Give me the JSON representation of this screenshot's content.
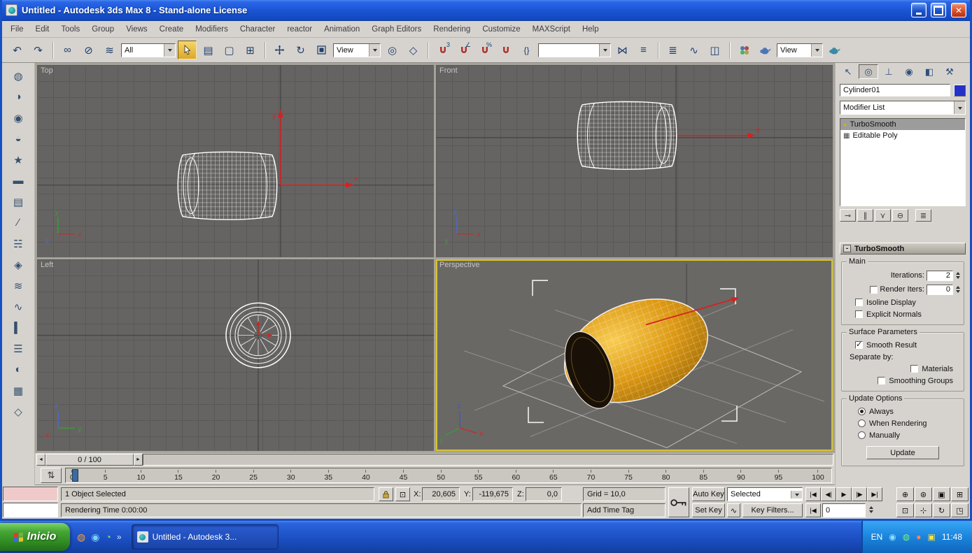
{
  "window": {
    "title": "Untitled - Autodesk 3ds Max 8  - Stand-alone License"
  },
  "menubar": {
    "items": [
      "File",
      "Edit",
      "Tools",
      "Group",
      "Views",
      "Create",
      "Modifiers",
      "Character",
      "reactor",
      "Animation",
      "Graph Editors",
      "Rendering",
      "Customize",
      "MAXScript",
      "Help"
    ]
  },
  "toolbar": {
    "selection_filter_value": "All",
    "ref_coord_value": "View",
    "named_sets_value": "",
    "render_type_value": "View"
  },
  "icons": {
    "undo": "↶",
    "redo": "↷",
    "link": "∞",
    "unlink": "⊘",
    "spacewarp": "≋",
    "select_by_name": "▤",
    "rect_region": "▢",
    "window_crossing": "⊞",
    "rotate": "↻",
    "pivot_center": "◎",
    "manipulate": "◇",
    "snap_super": "3",
    "angle_snap": "∠",
    "percent_snap": "%",
    "named_sets": "{}",
    "mirror": "⋈",
    "align": "≡",
    "layers": "≣",
    "curve_editor": "∿",
    "schematic": "◫",
    "abs_mode": "⊡",
    "mini_curve": "⇅",
    "key_mode": "∿",
    "zoom": "⊕",
    "zoom_all": "⊛",
    "zoom_extents": "▣",
    "zoom_extents_all": "⊞",
    "zoom_region": "⊡",
    "pan": "⊹",
    "arc_rotate": "↻",
    "maximize_toggle": "◳",
    "slider_prev": "◄",
    "slider_next": "►",
    "stack_on_bulb": "●",
    "stack_poly": "▦",
    "pin_stack": "⊸",
    "show_end_result": "∥",
    "make_unique": "⋎",
    "remove_modifier": "⊖",
    "configure_sets": "≣",
    "tab_create": "↖",
    "tab_modify": "◎",
    "tab_hierarchy": "⊥",
    "tab_motion": "◉",
    "tab_display": "◧",
    "tab_utilities": "⚒",
    "minus": "-",
    "chevron_double": "»"
  },
  "left_toolbar": {
    "icons": [
      "◍",
      "◑",
      "◉",
      "◒",
      "★",
      "▬",
      "▤",
      "∕",
      "☵",
      "◈",
      "≋",
      "∿",
      "▍",
      "☰",
      "◐",
      "▦",
      "◇"
    ]
  },
  "viewports": {
    "top_label": "Top",
    "front_label": "Front",
    "left_label": "Left",
    "perspective_label": "Perspective",
    "axis_x": "x",
    "axis_y": "y",
    "axis_z": "z"
  },
  "command_panel": {
    "object_name": "Cylinder01",
    "modifier_list_label": "Modifier List",
    "stack": {
      "item1": "TurboSmooth",
      "item2": "Editable Poly"
    },
    "rollout_title": "TurboSmooth",
    "groups": {
      "main": "Main",
      "surface": "Surface Parameters",
      "update": "Update Options"
    },
    "fields": {
      "iterations_label": "Iterations:",
      "iterations_value": "2",
      "render_iters_label": "Render Iters:",
      "render_iters_value": "0",
      "isoline_label": "Isoline Display",
      "explicit_normals_label": "Explicit Normals",
      "smooth_result_label": "Smooth Result",
      "separate_by_label": "Separate by:",
      "materials_label": "Materials",
      "smoothing_groups_label": "Smoothing Groups",
      "always_label": "Always",
      "when_rendering_label": "When Rendering",
      "manually_label": "Manually",
      "update_button": "Update"
    }
  },
  "time_slider": {
    "handle": "0 / 100"
  },
  "track_bar": {
    "ticks": [
      "0",
      "5",
      "10",
      "15",
      "20",
      "25",
      "30",
      "35",
      "40",
      "45",
      "50",
      "55",
      "60",
      "65",
      "70",
      "75",
      "80",
      "85",
      "90",
      "95",
      "100"
    ]
  },
  "status_bar": {
    "selection_text": "1 Object Selected",
    "x_label": "X:",
    "x_value": "20,605",
    "y_label": "Y:",
    "y_value": "-119,675",
    "z_label": "Z:",
    "z_value": "0,0",
    "grid_text": "Grid = 10,0",
    "rendering_time_text": "Rendering Time  0:00:00",
    "add_time_tag_text": "Add Time Tag"
  },
  "anim_controls": {
    "auto_key": "Auto Key",
    "set_key": "Set Key",
    "selected_value": "Selected",
    "key_filters": "Key Filters...",
    "frame_value": "0",
    "goto_start": "|◀",
    "prev_frame": "◀|",
    "play": "▶",
    "next_frame": "|▶",
    "goto_end": "▶|"
  },
  "taskbar": {
    "start_label": "Inicio",
    "quick_launch": [
      "◍",
      "◉",
      "◔"
    ],
    "task_title": "Untitled - Autodesk 3...",
    "tray_icons": [
      "◉",
      "◍",
      "●",
      "▣"
    ],
    "lang": "EN",
    "time": "11:48"
  },
  "colors": {
    "titlebar_blue": "#1c55d4",
    "taskbar_blue": "#1c4fc4",
    "start_green": "#2f8a22",
    "viewport_gray": "#666462",
    "active_viewport_border": "#d6c22e",
    "barrel_orange": "#dd9914",
    "selected_tool_gold": "#e8bc4a",
    "object_color_swatch": "#2331c8",
    "mini_listener_pink": "#f0caca"
  }
}
